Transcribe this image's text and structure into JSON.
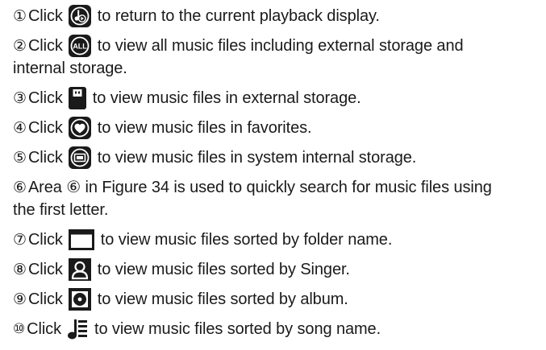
{
  "lines": [
    {
      "num": "①",
      "pre": "Click",
      "icon": "playback-icon",
      "post": "to return to the current playback display."
    },
    {
      "num": "②",
      "pre": "Click",
      "icon": "all-icon",
      "icon_text": "ALL",
      "post": "to view all music files including external storage and"
    },
    {
      "text": "internal storage."
    },
    {
      "num": "③",
      "pre": "Click",
      "icon": "usb-icon",
      "post": "to view music files in external storage."
    },
    {
      "num": "④",
      "pre": "Click",
      "icon": "heart-icon",
      "post": "to view music files in favorites."
    },
    {
      "num": "⑤",
      "pre": "Click",
      "icon": "internal-storage-icon",
      "post": "to view music files in system internal storage."
    },
    {
      "num": "⑥",
      "text": "Area ⑥ in Figure 34 is used to quickly search for music files using"
    },
    {
      "text": "the first letter."
    },
    {
      "num": "⑦",
      "pre": "Click",
      "icon": "folder-icon",
      "post": "to view music files sorted by folder name."
    },
    {
      "num": "⑧",
      "pre": "Click",
      "icon": "singer-icon",
      "post": "to view music files sorted by Singer."
    },
    {
      "num": "⑨",
      "pre": "Click",
      "icon": "album-icon",
      "post": "to view music files sorted by album."
    },
    {
      "num": "⑩",
      "pre": "Click",
      "icon": "song-icon",
      "post": "to view music files sorted by song name."
    }
  ],
  "colors": {
    "text": "#1a1a1a",
    "icon": "#1a1a1a",
    "icon_fg": "#ffffff"
  }
}
